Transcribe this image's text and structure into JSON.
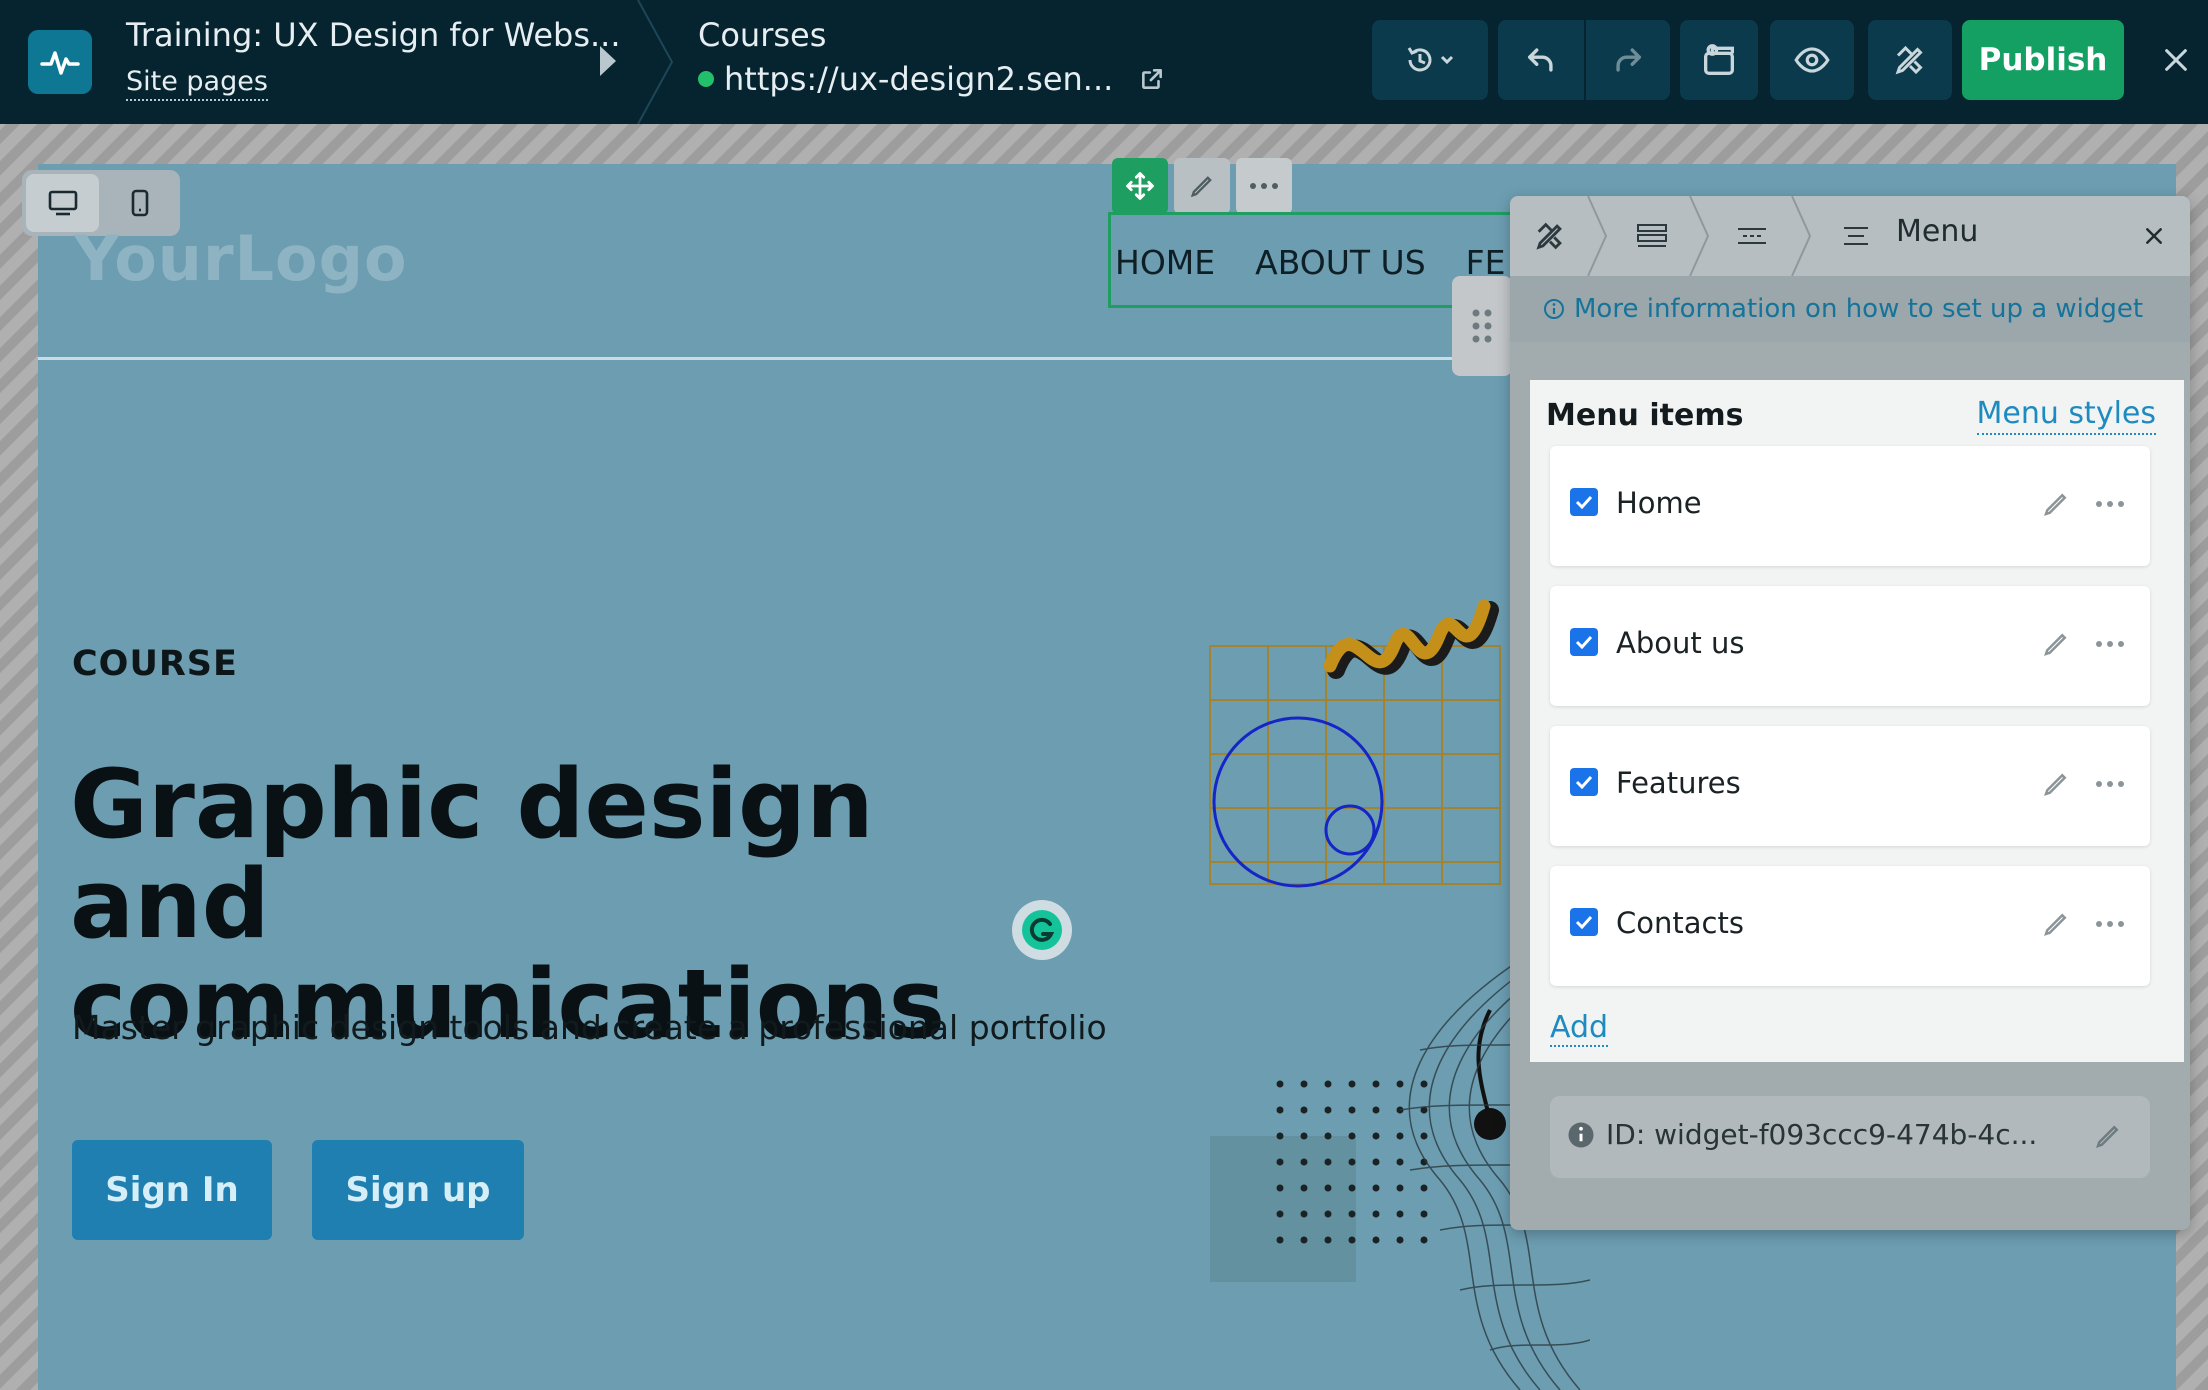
{
  "topbar": {
    "site_title": "Training: UX Design for Webs...",
    "site_pages": "Site pages",
    "page_name": "Courses",
    "page_url": "https://ux-design2.sen...",
    "publish_label": "Publish",
    "icons": [
      "history-icon",
      "undo-icon",
      "redo-icon",
      "layers-icon",
      "preview-icon",
      "design-icon",
      "close-icon"
    ]
  },
  "canvas": {
    "logo": "YourLogo",
    "nav": [
      "HOME",
      "ABOUT US",
      "FE"
    ],
    "course_label": "COURSE",
    "hero_title_line1": "Graphic design and",
    "hero_title_line2": "communications",
    "hero_subtitle": "Master graphic design tools and create a professional portfolio",
    "sign_in": "Sign In",
    "sign_up": "Sign up"
  },
  "panel": {
    "title": "Menu",
    "info": "More information on how to set up a widget",
    "menu_items_heading": "Menu items",
    "menu_styles_link": "Menu styles",
    "items": [
      {
        "label": "Home",
        "checked": true
      },
      {
        "label": "About us",
        "checked": true
      },
      {
        "label": "Features",
        "checked": true
      },
      {
        "label": "Contacts",
        "checked": true
      }
    ],
    "add_label": "Add",
    "widget_id": "ID: widget-f093ccc9-474b-4c..."
  },
  "colors": {
    "topbar_bg": "#052430",
    "publish": "#14a063",
    "site_bg": "#6c9db1",
    "link": "#1d8bbf",
    "checkbox": "#1a73e8"
  }
}
